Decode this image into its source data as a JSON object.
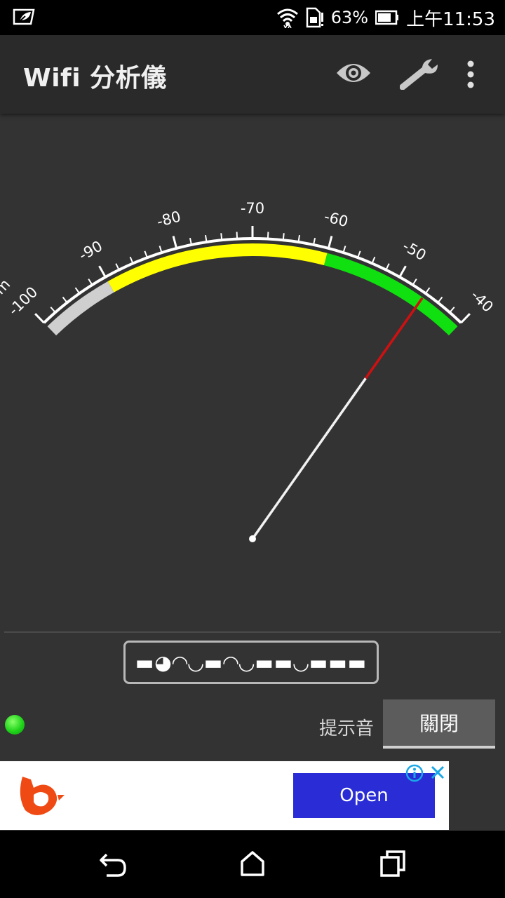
{
  "status_bar": {
    "battery_percent": "63%",
    "time": "上午11:53"
  },
  "app_bar": {
    "title": "Wifi 分析儀"
  },
  "gauge": {
    "unit": "dBm",
    "ticks": [
      "-100",
      "-90",
      "-80",
      "-70",
      "-60",
      "-50",
      "-40"
    ],
    "reading_dbm": -46,
    "zones": [
      {
        "from": -100,
        "to": -90,
        "color": "#cfcfcf"
      },
      {
        "from": -90,
        "to": -60,
        "color": "#ffff00"
      },
      {
        "from": -60,
        "to": -40,
        "color": "#10e010"
      }
    ],
    "needle_color": "#f2f2f2",
    "needle_tip_color": "#d01010"
  },
  "ssid": {
    "name": "▬◕◠◡▬◠◡▬▬◡▬▬▬"
  },
  "beep": {
    "label": "提示音",
    "state": "關閉"
  },
  "ad": {
    "open_label": "Open",
    "accent": "#2a2dd6"
  },
  "colors": {
    "background": "#333333",
    "indicator": "#1fd41a"
  }
}
